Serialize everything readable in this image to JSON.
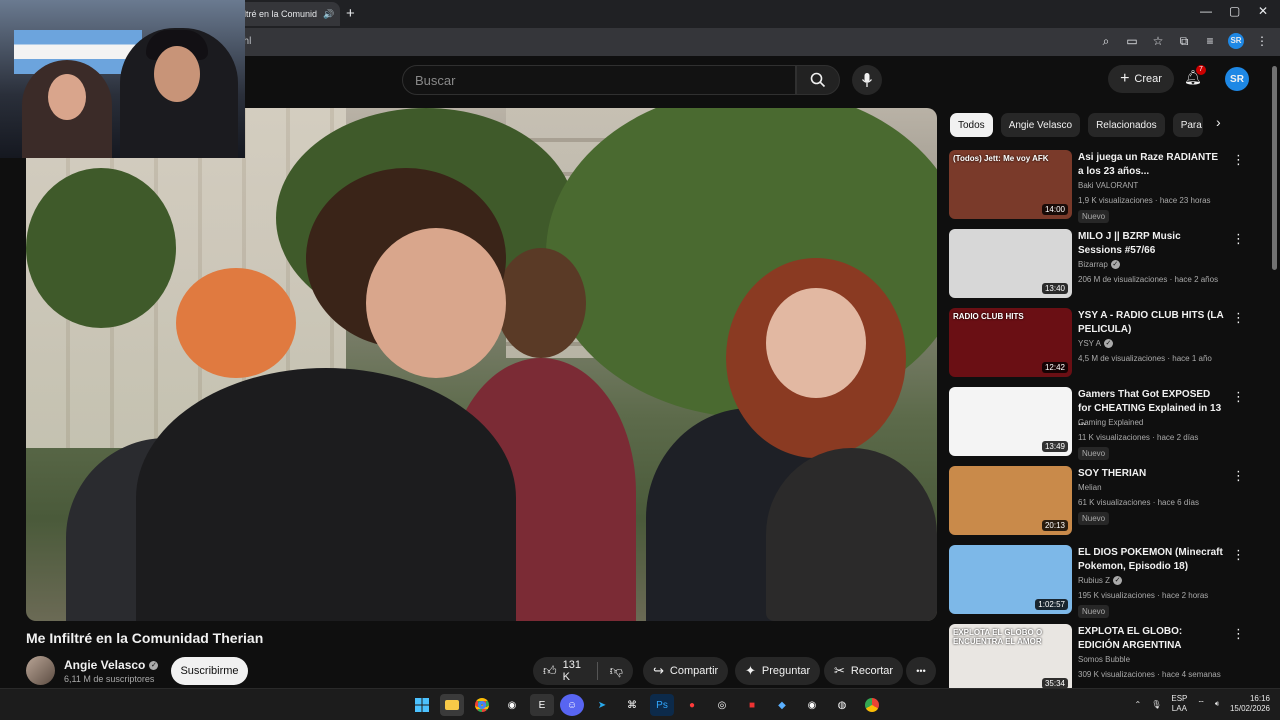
{
  "browser": {
    "tab_title": "ltré en la Comunid",
    "url_fragment": "ehl",
    "newtab_label": "+",
    "window_controls": [
      "—",
      "▢",
      "✕"
    ]
  },
  "header": {
    "search_placeholder": "Buscar",
    "create_label": "Crear",
    "notif_count": "7",
    "avatar_initials": "SR"
  },
  "video": {
    "title": "Me Infiltré en la Comunidad Therian",
    "channel": "Angie Velasco",
    "subscribers": "6,11 M de suscriptores",
    "subscribe_label": "Suscribirme",
    "likes": "131 K",
    "share_label": "Compartir",
    "ask_label": "Preguntar",
    "clip_label": "Recortar",
    "more_label": "•••"
  },
  "sidebar": {
    "chips": [
      "Todos",
      "Angie Velasco",
      "Relacionados",
      "Para"
    ],
    "items": [
      {
        "title": "Asi juega un Raze RADIANTE a los 23 años...",
        "channel": "Baki VALORANT",
        "verified": false,
        "meta": "1,9 K visualizaciones  ·  hace 23 horas",
        "badge": "Nuevo",
        "duration": "14:00",
        "thumb_text": "(Todos) Jett: Me voy AFK",
        "color": "#7a3a2a"
      },
      {
        "title": "MILO J || BZRP Music Sessions #57/66",
        "channel": "Bizarrap",
        "verified": true,
        "meta": "206 M de visualizaciones  ·  hace 2 años",
        "badge": "",
        "duration": "13:40",
        "thumb_text": "",
        "color": "#d7d7d7"
      },
      {
        "title": "YSY A - RADIO CLUB HITS (LA PELICULA)",
        "channel": "YSY A",
        "verified": true,
        "meta": "4,5 M de visualizaciones  ·  hace 1 año",
        "badge": "",
        "duration": "12:42",
        "thumb_text": "RADIO CLUB HITS",
        "color": "#6a0f14"
      },
      {
        "title": "Gamers That Got EXPOSED for CHEATING Explained in 13 ...",
        "channel": "Gaming Explained",
        "verified": false,
        "meta": "11 K visualizaciones  ·  hace 2 días",
        "badge": "Nuevo",
        "duration": "13:49",
        "thumb_text": "",
        "color": "#f4f4f4"
      },
      {
        "title": "SOY THERIAN",
        "channel": "Melian",
        "verified": false,
        "meta": "61 K visualizaciones  ·  hace 6 días",
        "badge": "Nuevo",
        "duration": "20:13",
        "thumb_text": "",
        "color": "#c98a4a"
      },
      {
        "title": "EL DIOS POKEMON (Minecraft Pokemon, Episodio 18)",
        "channel": "Rubius Z",
        "verified": true,
        "meta": "195 K visualizaciones  ·  hace 2 horas",
        "badge": "Nuevo",
        "duration": "1:02:57",
        "thumb_text": "",
        "color": "#7db8e8"
      },
      {
        "title": "EXPLOTA EL GLOBO: EDICIÓN ARGENTINA",
        "channel": "Somos Bubble",
        "verified": false,
        "meta": "309 K visualizaciones  ·  hace 4 semanas",
        "badge": "",
        "duration": "35:34",
        "thumb_text": "EXPLOTA EL GLOBO O ENCUENTRA EL AMOR",
        "color": "#e9e6e2"
      }
    ]
  },
  "taskbar": {
    "lang_top": "ESP",
    "lang_bottom": "LAA",
    "time": "16:16",
    "date": "15/02/2026"
  }
}
